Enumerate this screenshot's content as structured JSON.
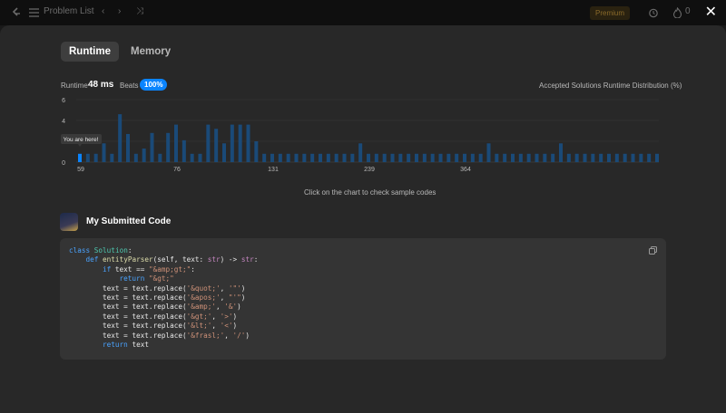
{
  "header": {
    "breadcrumb": "Problem List",
    "premium_label": "Premium",
    "counter": "0"
  },
  "tabs": [
    {
      "label": "Runtime",
      "active": true
    },
    {
      "label": "Memory",
      "active": false
    }
  ],
  "stats": {
    "runtime_label": "Runtime",
    "runtime_value": "48 ms",
    "beats_label": "Beats",
    "beats_value": "100%"
  },
  "chart_title": "Accepted Solutions Runtime Distribution (%)",
  "chart_hint": "Click on the chart to check sample codes",
  "chart_data": {
    "type": "bar",
    "ylim": [
      0,
      6
    ],
    "yticks": [
      "6",
      "4",
      "2",
      "0"
    ],
    "xtick_labels": [
      "59",
      "76",
      "131",
      "239",
      "364"
    ],
    "xtick_index": [
      0,
      12,
      24,
      36,
      48
    ],
    "values": [
      0.8,
      0.8,
      0.8,
      1.8,
      0.8,
      4.6,
      2.7,
      0.8,
      1.3,
      2.8,
      0.8,
      2.8,
      3.6,
      2.1,
      0.8,
      0.8,
      3.6,
      3.2,
      1.8,
      3.6,
      3.6,
      3.6,
      2.0,
      0.8,
      0.8,
      0.8,
      0.8,
      0.8,
      0.8,
      0.8,
      0.8,
      0.8,
      0.8,
      0.8,
      0.8,
      1.8,
      0.8,
      0.8,
      0.8,
      0.8,
      0.8,
      0.8,
      0.8,
      0.8,
      0.8,
      0.8,
      0.8,
      0.8,
      0.8,
      0.8,
      0.8,
      1.8,
      0.8,
      0.8,
      0.8,
      0.8,
      0.8,
      0.8,
      0.8,
      0.8,
      1.8,
      0.8,
      0.8,
      0.8,
      0.8,
      0.8,
      0.8,
      0.8,
      0.8,
      0.8,
      0.8,
      0.8,
      0.8
    ],
    "highlight_index": 0,
    "tooltip": "You are here!",
    "grid": true
  },
  "submission": {
    "title": "My Submitted Code",
    "copy_icon": "copy-icon"
  },
  "code_lines": [
    "class Solution:",
    "    def entityParser(self, text: str) -> str:",
    "        if text == \"&amp;gt;\":",
    "            return \"&gt;\"",
    "        text = text.replace('&quot;', '\"')",
    "        text = text.replace('&apos;', \"'\")",
    "        text = text.replace('&amp;', '&')",
    "        text = text.replace('&gt;', '>')",
    "        text = text.replace('&lt;', '<')",
    "        text = text.replace('&frasl;', '/')",
    "        return text"
  ],
  "colors": {
    "bar": "#1a4a78",
    "bar_highlight": "#0a84ff",
    "badge": "#0a84ff",
    "premium": "#ffa116"
  }
}
